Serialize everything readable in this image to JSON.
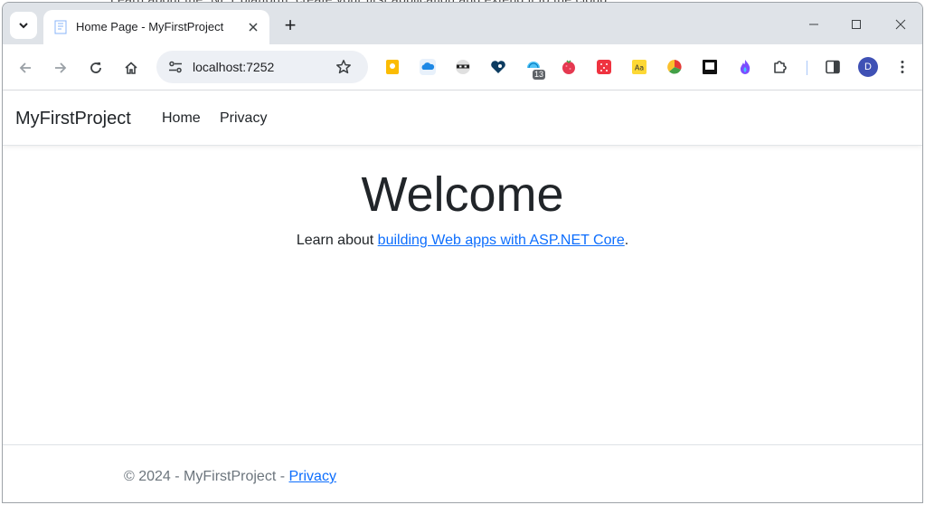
{
  "browser": {
    "tab_title": "Home Page - MyFirstProject",
    "new_tab_symbol": "+",
    "url": "localhost:7252",
    "profile_initial": "D",
    "extensions_badge": "13"
  },
  "site": {
    "brand": "MyFirstProject",
    "nav": [
      "Home",
      "Privacy"
    ],
    "heading": "Welcome",
    "lead_prefix": "Learn about ",
    "lead_link": "building Web apps with ASP.NET Core",
    "lead_suffix": ".",
    "footer_text": "© 2024 - MyFirstProject - ",
    "footer_link": "Privacy"
  },
  "colors": {
    "tabstrip": "#dfe3e8",
    "link": "#0d6efd",
    "avatar": "#3f51b5"
  }
}
